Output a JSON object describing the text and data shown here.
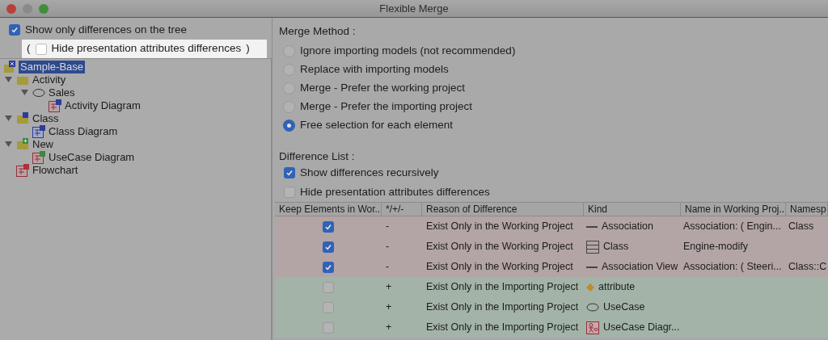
{
  "window": {
    "title": "Flexible Merge"
  },
  "tree_options": {
    "show_only_differences": {
      "label": "Show only differences on the tree",
      "checked": true
    },
    "hide_presentation": {
      "open_paren": "(",
      "label": "Hide presentation attributes differences",
      "close_paren": ")",
      "checked": false
    }
  },
  "tree": [
    {
      "label": "Sample-Base",
      "kind": "project",
      "selected": true,
      "children": [
        {
          "label": "Activity",
          "kind": "folder",
          "expanded": true,
          "selected": false,
          "children": [
            {
              "label": "Sales",
              "kind": "usecase",
              "expanded": true,
              "selected": false,
              "children": [
                {
                  "label": "Activity Diagram",
                  "kind": "activitydiagram",
                  "selected": false
                }
              ]
            }
          ]
        },
        {
          "label": "Class",
          "kind": "modelfolder",
          "expanded": true,
          "selected": false,
          "children": [
            {
              "label": "Class Diagram",
              "kind": "classdiagram",
              "selected": false
            }
          ]
        },
        {
          "label": "New",
          "kind": "newfolder",
          "expanded": true,
          "selected": false,
          "children": [
            {
              "label": "UseCase Diagram",
              "kind": "usecasediagram",
              "selected": false
            }
          ]
        },
        {
          "label": "Flowchart",
          "kind": "flowchart",
          "selected": false
        }
      ]
    }
  ],
  "merge_method": {
    "label": "Merge Method :",
    "options": [
      {
        "label": "Ignore importing models (not recommended)",
        "selected": false
      },
      {
        "label": "Replace with importing models",
        "selected": false
      },
      {
        "label": "Merge - Prefer the working project",
        "selected": false
      },
      {
        "label": "Merge - Prefer the importing project",
        "selected": false
      },
      {
        "label": "Free selection for each element",
        "selected": true
      }
    ]
  },
  "difference_list": {
    "label": "Difference List :",
    "options": [
      {
        "label": "Show differences recursively",
        "checked": true
      },
      {
        "label": "Hide presentation attributes differences",
        "checked": false
      }
    ],
    "table": {
      "columns": [
        "Keep Elements in Wor...",
        "*/+/-",
        "Reason of Difference",
        "Kind",
        "Name in Working Proj...",
        "Namesp"
      ],
      "rows": [
        {
          "keep": true,
          "sign": "-",
          "reason": "Exist Only in the Working Project",
          "kind": "line",
          "kind_label": "Association",
          "name": "Association: ( Engin...",
          "namespace": "Class",
          "color": "#b3a4a5"
        },
        {
          "keep": true,
          "sign": "-",
          "reason": "Exist Only in the Working Project",
          "kind": "class",
          "kind_label": "Class",
          "name": "Engine-modify",
          "color": "#b3a4a5"
        },
        {
          "keep": true,
          "sign": "-",
          "reason": "Exist Only in the Working Project",
          "kind": "line",
          "kind_label": "Association View",
          "name": "Association: ( Steeri...",
          "namespace": "Class::C",
          "color": "#b3a4a5"
        },
        {
          "keep": false,
          "sign": "+",
          "reason": "Exist Only in the Importing Project",
          "kind": "diamond",
          "kind_label": "attribute",
          "color": "#a3b3a8"
        },
        {
          "keep": false,
          "sign": "+",
          "reason": "Exist Only in the Importing Project",
          "kind": "ellipse",
          "kind_label": "UseCase",
          "color": "#a3b3a8"
        },
        {
          "keep": false,
          "sign": "+",
          "reason": "Exist Only in the Importing Project",
          "kind": "usecasediagram",
          "kind_label": "UseCase Diagr...",
          "color": "#a3b3a8"
        }
      ]
    }
  }
}
